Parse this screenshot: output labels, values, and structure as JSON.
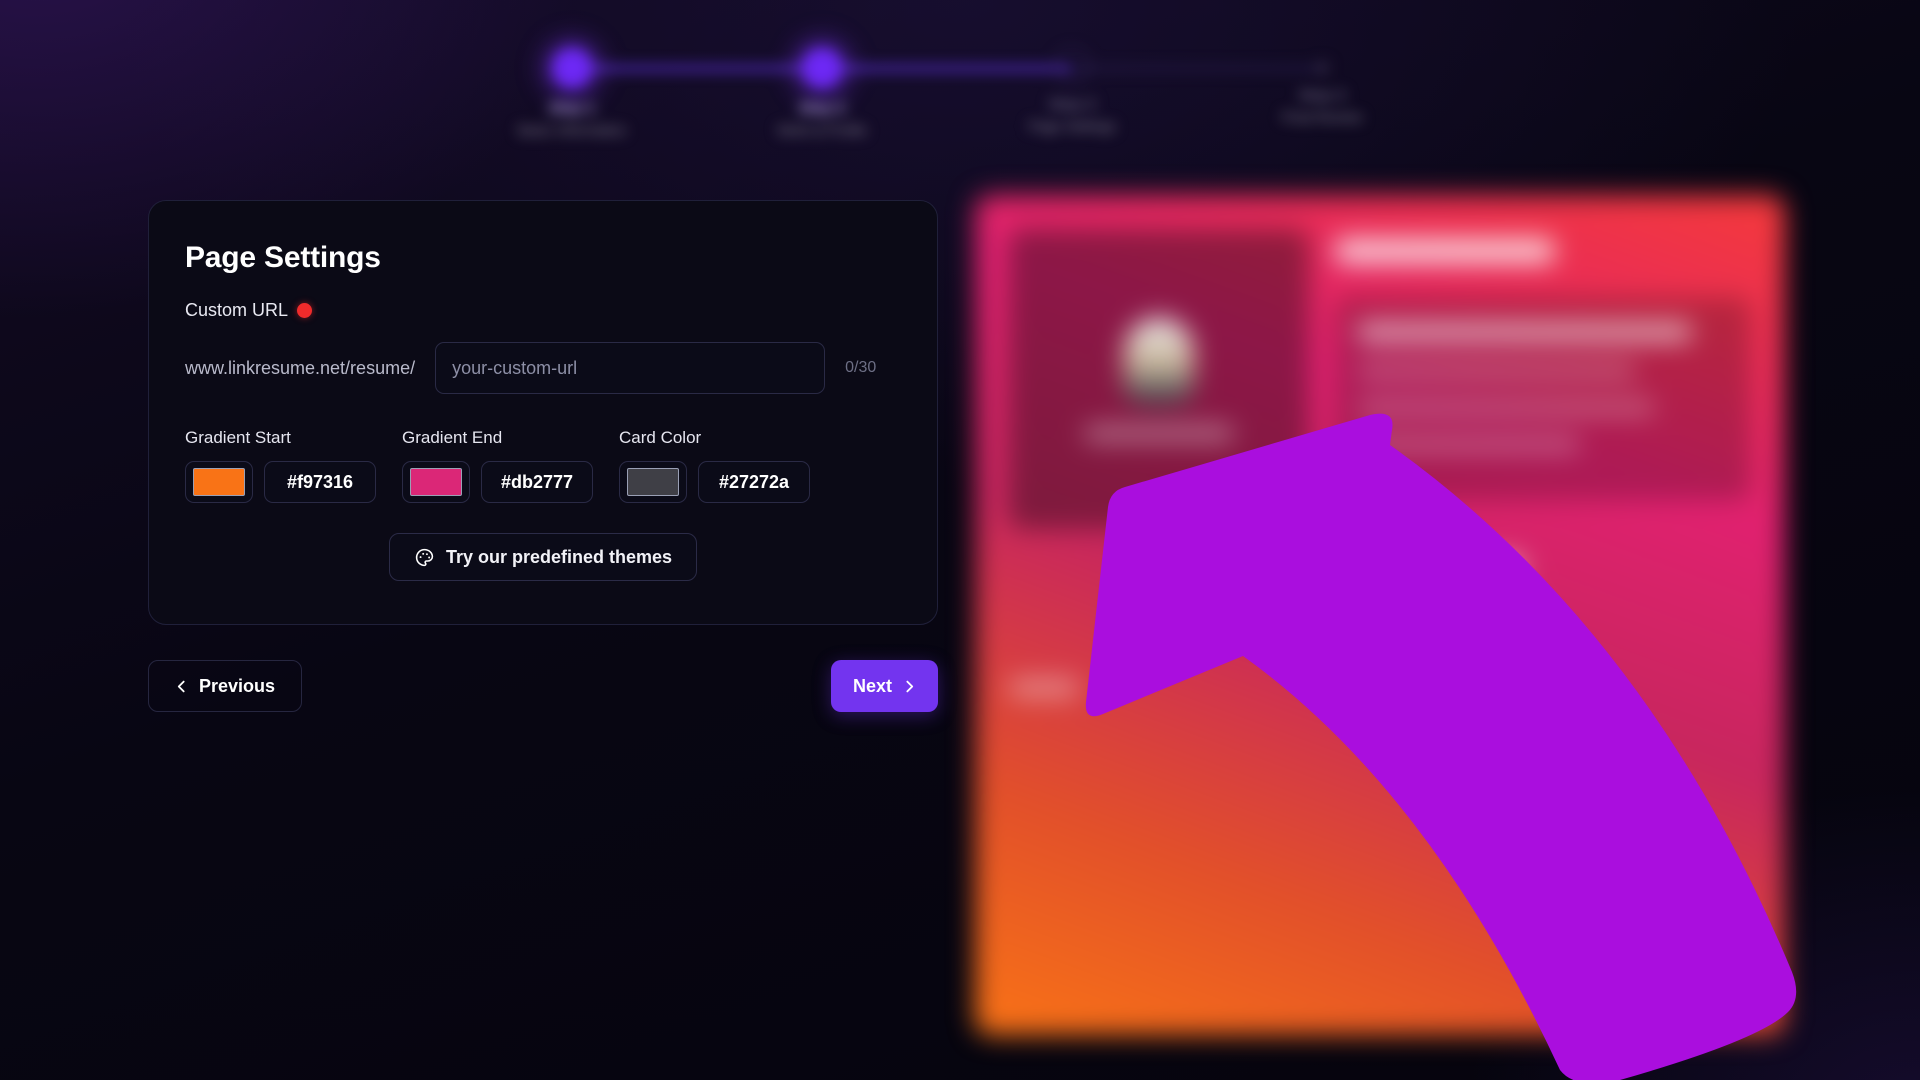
{
  "app": {
    "background_color": "#0a0714",
    "accent_color": "#7334ef"
  },
  "stepper": {
    "steps": [
      {
        "label": "Step 1",
        "sub": "Basic Information",
        "state": "done"
      },
      {
        "label": "Step 2",
        "sub": "Work & Profile",
        "state": "done"
      },
      {
        "label": "Step 3",
        "sub": "Page Settings",
        "state": "current"
      },
      {
        "label": "Step 4",
        "sub": "Final Review",
        "state": "upcoming"
      }
    ]
  },
  "settings_card": {
    "title": "Page Settings",
    "custom_url": {
      "label": "Custom URL",
      "status_color": "#ef2b2b",
      "prefix": "www.linkresume.net/resume/",
      "value": "",
      "placeholder": "your-custom-url",
      "char_count": "0/30"
    },
    "colors": [
      {
        "label": "Gradient Start",
        "hex": "#f97316",
        "swatch": "#f97316"
      },
      {
        "label": "Gradient End",
        "hex": "#db2777",
        "swatch": "#db2777"
      },
      {
        "label": "Card Color",
        "hex": "#27272a",
        "swatch": "#3f3f46"
      }
    ],
    "themes_button": {
      "label": "Try our predefined themes",
      "icon": "palette-icon"
    }
  },
  "navigation": {
    "previous": {
      "label": "Previous",
      "icon": "chevron-left-icon"
    },
    "next": {
      "label": "Next",
      "icon": "chevron-right-icon"
    }
  },
  "preview": {
    "gradient_start": "#f97316",
    "gradient_end": "#db2777",
    "card_color": "#27272a"
  },
  "annotation": {
    "arrow_color": "#aa0ede"
  }
}
